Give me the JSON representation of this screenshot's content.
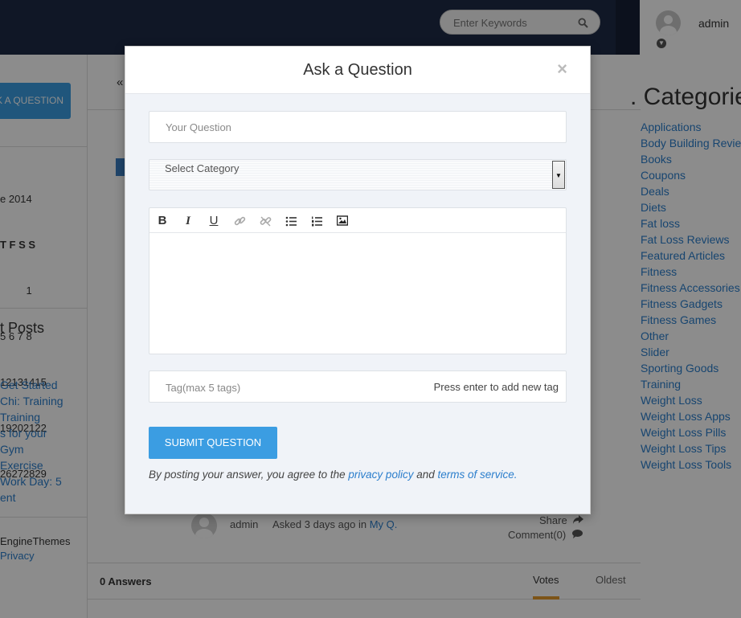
{
  "topbar": {
    "search_placeholder": "Enter Keywords",
    "user_name": "admin"
  },
  "left": {
    "ask_button": "K A QUESTION",
    "calendar_month": "e 2014",
    "calendar_days": "T F S S",
    "calendar_rows": [
      "         1",
      "5 6 7 8",
      "12131415",
      "19202122",
      "26272829"
    ],
    "recent_title": "t Posts",
    "recent_items": [
      "Get Started",
      "Chi: Training",
      "Training",
      "s for your",
      "Gym",
      "Exercise",
      "Work Day: 5",
      "ent"
    ],
    "footer_line1": "EngineThemes",
    "footer_line2": "Privacy"
  },
  "main": {
    "back_arrow": "«",
    "post_author": "admin",
    "post_asked_prefix": "Asked 3 days ago in",
    "post_category": "My Q.",
    "share_label": "Share",
    "comment_label": "Comment(0)",
    "answers_count": "0 Answers",
    "tab_votes": "Votes",
    "tab_oldest": "Oldest"
  },
  "categories": {
    "title": ". Categorie",
    "items": [
      "Applications",
      "Body Building Review",
      "Books",
      "Coupons",
      "Deals",
      "Diets",
      "Fat loss",
      "Fat Loss Reviews",
      "Featured Articles",
      "Fitness",
      "Fitness Accessories",
      "Fitness Gadgets",
      "Fitness Games",
      "Other",
      "Slider",
      "Sporting Goods",
      "Training",
      "Weight Loss",
      "Weight Loss Apps",
      "Weight Loss Pills",
      "Weight Loss Tips",
      "Weight Loss Tools"
    ]
  },
  "modal": {
    "title": "Ask a Question",
    "close": "×",
    "question_placeholder": "Your Question",
    "category_selected": "Select Category",
    "tag_placeholder": "Tag(max 5 tags)",
    "tag_hint": "Press enter to add new tag",
    "submit_label": "SUBMIT QUESTION",
    "terms_prefix": "By posting your answer, you agree to the",
    "privacy_link": "privacy policy",
    "terms_and": "and",
    "terms_link": "terms of service."
  },
  "colors": {
    "accent": "#3b9de2",
    "topbar": "#1e2a45",
    "link": "#2b7ecc"
  }
}
